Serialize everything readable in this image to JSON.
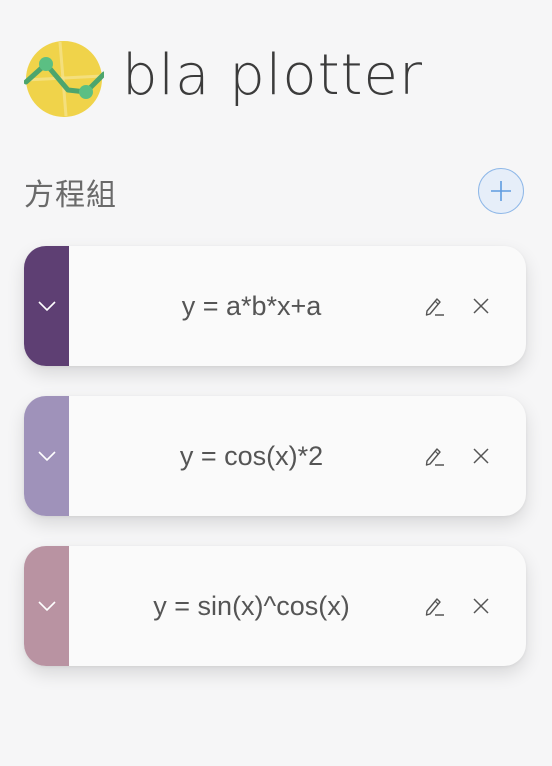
{
  "app": {
    "title": "bla plotter"
  },
  "equations_section": {
    "title": "方程組"
  },
  "equations": [
    {
      "expression": "y = a*b*x+a",
      "color": "#5e3f73"
    },
    {
      "expression": "y = cos(x)*2",
      "color": "#9f92ba"
    },
    {
      "expression": "y = sin(x)^cos(x)",
      "color": "#b993a2"
    }
  ],
  "icons": {
    "logo": "plotter-logo",
    "add": "plus-icon",
    "expand": "chevron-down-icon",
    "edit": "pencil-icon",
    "remove": "close-icon"
  },
  "colors": {
    "logo_circle": "#f0d34a",
    "logo_line": "#4da56d",
    "add_border": "#8fb8e8",
    "add_fill": "#e6eef9"
  }
}
